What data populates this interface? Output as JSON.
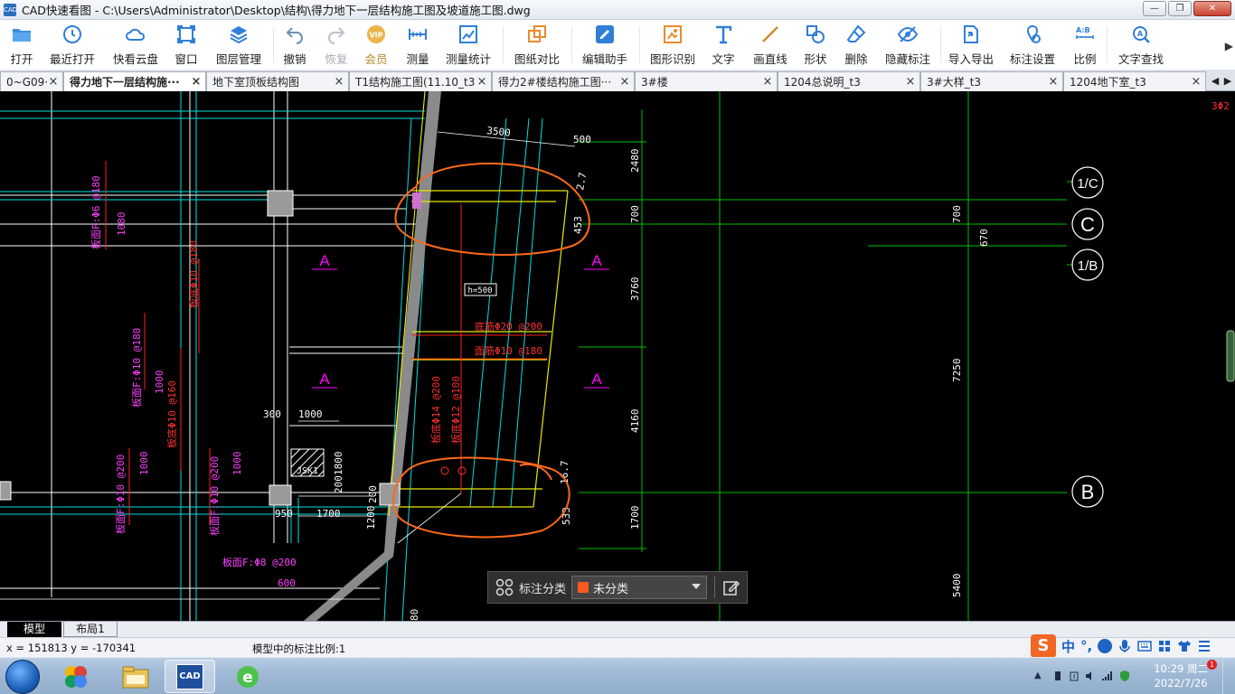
{
  "window": {
    "title": "CAD快速看图 - C:\\Users\\Administrator\\Desktop\\结构\\得力地下一层结构施工图及坡道施工图.dwg",
    "app_badge": "CAD",
    "minimize": "—",
    "maximize": "❐",
    "close": "✕"
  },
  "toolbar": {
    "items": [
      {
        "label": "打开",
        "icon": "folder-open-icon"
      },
      {
        "label": "最近打开",
        "icon": "recent-clock-icon"
      },
      {
        "label": "快看云盘",
        "icon": "cloud-icon"
      },
      {
        "label": "窗口",
        "icon": "window-icon"
      },
      {
        "label": "图层管理",
        "icon": "layers-icon"
      },
      {
        "label": "撤销",
        "icon": "undo-icon"
      },
      {
        "label": "恢复",
        "icon": "redo-icon"
      },
      {
        "label": "会员",
        "icon": "vip-icon"
      },
      {
        "label": "测量",
        "icon": "measure-ruler-icon"
      },
      {
        "label": "测量统计",
        "icon": "measure-stats-icon"
      },
      {
        "label": "图纸对比",
        "icon": "compare-icon"
      },
      {
        "label": "编辑助手",
        "icon": "edit-assistant-icon"
      },
      {
        "label": "图形识别",
        "icon": "shape-recognize-icon"
      },
      {
        "label": "文字",
        "icon": "text-t-icon"
      },
      {
        "label": "画直线",
        "icon": "line-icon"
      },
      {
        "label": "形状",
        "icon": "shape-icon"
      },
      {
        "label": "删除",
        "icon": "eraser-icon"
      },
      {
        "label": "隐藏标注",
        "icon": "eye-hide-icon"
      },
      {
        "label": "导入导出",
        "icon": "import-export-icon"
      },
      {
        "label": "标注设置",
        "icon": "annotation-settings-icon"
      },
      {
        "label": "比例",
        "icon": "scale-icon"
      },
      {
        "label": "文字查找",
        "icon": "text-search-icon"
      }
    ],
    "more": "▶"
  },
  "tabs": [
    {
      "label": "0~G09···",
      "active": false
    },
    {
      "label": "得力地下一层结构施···",
      "active": true
    },
    {
      "label": "地下室顶板结构图",
      "active": false
    },
    {
      "label": "T1结构施工图(11.10_t3",
      "active": false
    },
    {
      "label": "得力2#楼结构施工图···",
      "active": false
    },
    {
      "label": "3#楼",
      "active": false
    },
    {
      "label": "1204总说明_t3",
      "active": false
    },
    {
      "label": "3#大样_t3",
      "active": false
    },
    {
      "label": "1204地下室_t3",
      "active": false
    }
  ],
  "tab_nav": {
    "prev": "◀",
    "next": "▶",
    "close": "×"
  },
  "drawing": {
    "colors": {
      "background": "#000000",
      "grid": "#00ff00",
      "struct": "#ffffff",
      "cyan": "#00ffff",
      "yellow": "#ffff00",
      "magenta": "#ff00ff",
      "red": "#ff0000",
      "orange_markup": "#ff6a1a"
    },
    "axis_labels": [
      "1/C",
      "C",
      "1/B",
      "B"
    ],
    "dimensions": [
      "3500",
      "500",
      "2480",
      "700",
      "700",
      "670",
      "3760",
      "7250",
      "4160",
      "1700",
      "5400",
      "300",
      "1000",
      "950",
      "1700",
      "1200",
      "200",
      "200",
      "1000",
      "1000",
      "1000",
      "1000",
      "1800",
      "1080",
      "600",
      "80",
      "453",
      "2.7",
      "533",
      "16.7"
    ],
    "section_marks": [
      "A",
      "A",
      "A",
      "A"
    ],
    "box_label": "h=500",
    "red_notes": [
      "底筋Φ20 @200",
      "面筋Φ10 @180",
      "板底Φ14 @200",
      "板底Φ12 @100",
      "板底Φ10 @180",
      "板底Φ10 @160"
    ],
    "magenta_notes": [
      "板面F:Φ6 @180",
      "板面F:Φ10 @180",
      "板面F:Φ10 @200",
      "板面F:Φ10 @200",
      "板面F:Φ8 @200"
    ],
    "hatch_label": "JSK1",
    "corner_note": "3Φ2"
  },
  "annotation_panel": {
    "label": "标注分类",
    "selected": "未分类",
    "swatch_color": "#ff5a1f"
  },
  "layout_tabs": [
    {
      "label": "模型",
      "active": true
    },
    {
      "label": "布局1",
      "active": false
    }
  ],
  "status": {
    "coords": "x = 151813 y = -170341",
    "scale_text": "模型中的标注比例:1"
  },
  "ime": {
    "brand": "S",
    "mode": "中",
    "punct": "°,"
  },
  "taskbar": {
    "apps": [
      {
        "name": "start",
        "icon": "windows-start-icon"
      },
      {
        "name": "browser-360",
        "icon": "browser-360-icon"
      },
      {
        "name": "explorer",
        "icon": "file-explorer-icon"
      },
      {
        "name": "cad",
        "icon": "cad-viewer-icon",
        "label": "CAD",
        "active": true
      },
      {
        "name": "ie",
        "icon": "browser-e-icon"
      }
    ],
    "time": "10:29 周二",
    "date": "2022/7/26",
    "notification_badge": "1"
  }
}
